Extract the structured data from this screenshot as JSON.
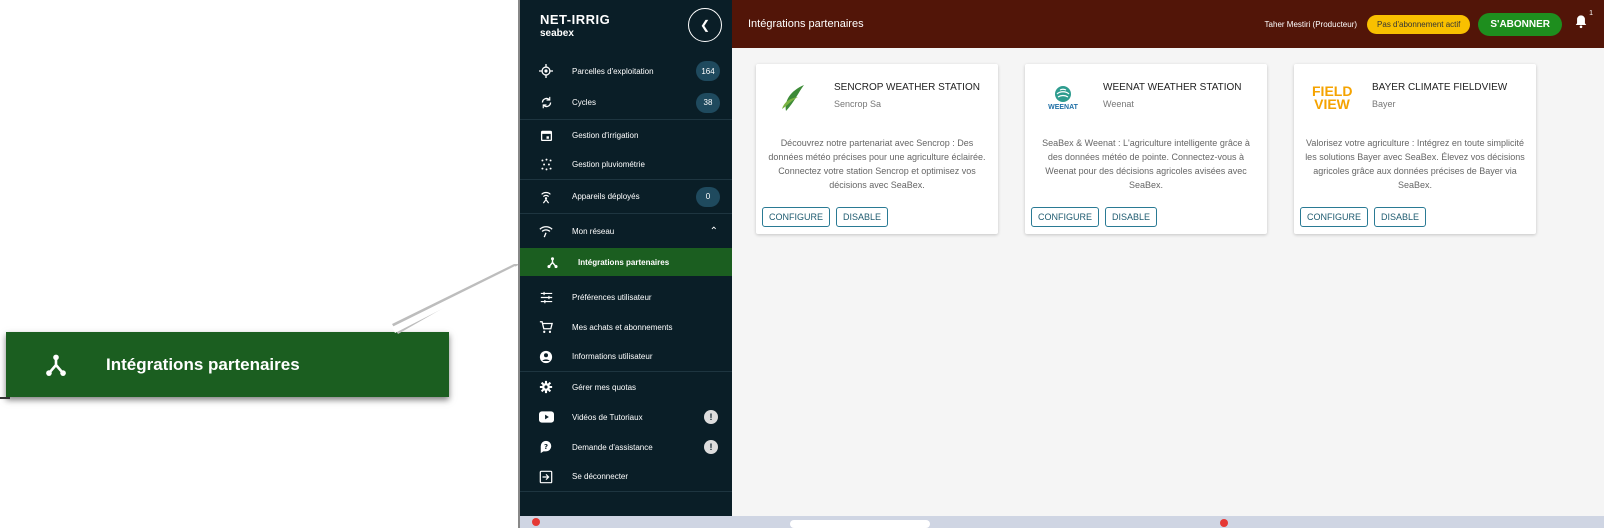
{
  "callout": {
    "label": "Intégrations partenaires"
  },
  "brand": {
    "name": "NET-IRRIG",
    "sub": "seabex"
  },
  "header": {
    "title": "Intégrations partenaires",
    "user": "Taher Mestiri (Producteur)",
    "subscription_status": "Pas d'abonnement actif",
    "subscribe_label": "S'ABONNER",
    "notification_count": "1"
  },
  "sidebar": {
    "items": [
      {
        "label": "Parcelles d'exploitation",
        "badge": "164"
      },
      {
        "label": "Cycles",
        "badge": "38"
      },
      {
        "label": "Gestion d'irrigation"
      },
      {
        "label": "Gestion pluviométrie"
      },
      {
        "label": "Appareils déployés",
        "badge": "0"
      },
      {
        "label": "Mon réseau"
      },
      {
        "label": "Intégrations partenaires"
      },
      {
        "label": "Préférences utilisateur"
      },
      {
        "label": "Mes achats et abonnements"
      },
      {
        "label": "Informations utilisateur"
      },
      {
        "label": "Gérer mes quotas"
      },
      {
        "label": "Vidéos de Tutoriaux"
      },
      {
        "label": "Demande d'assistance"
      },
      {
        "label": "Se déconnecter"
      }
    ]
  },
  "partners": [
    {
      "title": "SENCROP WEATHER STATION",
      "subtitle": "Sencrop Sa",
      "description": "Découvrez notre partenariat avec Sencrop : Des données météo précises pour une agriculture éclairée. Connectez votre station Sencrop et optimisez vos décisions avec SeaBex.",
      "configure": "CONFIGURE",
      "disable": "DISABLE"
    },
    {
      "title": "WEENAT WEATHER STATION",
      "subtitle": "Weenat",
      "logo_text": "WEENAT",
      "description": "SeaBex & Weenat : L'agriculture intelligente grâce à des données météo de pointe. Connectez-vous à Weenat pour des décisions agricoles avisées avec SeaBex.",
      "configure": "CONFIGURE",
      "disable": "DISABLE"
    },
    {
      "title": "BAYER CLIMATE FIELDVIEW",
      "subtitle": "Bayer",
      "logo_text": "FIELD VIEW",
      "description": "Valorisez votre agriculture : Intégrez en toute simplicité les solutions Bayer avec SeaBex. Élevez vos décisions agricoles grâce aux données précises de Bayer via SeaBex.",
      "configure": "CONFIGURE",
      "disable": "DISABLE"
    }
  ],
  "colors": {
    "sidebar_bg": "#0a1e27",
    "topbar_bg": "#521508",
    "active_green": "#1b5e20",
    "subscribe_green": "#1e8e1e",
    "status_yellow": "#f9c000",
    "outline_button": "#2a7a94"
  }
}
